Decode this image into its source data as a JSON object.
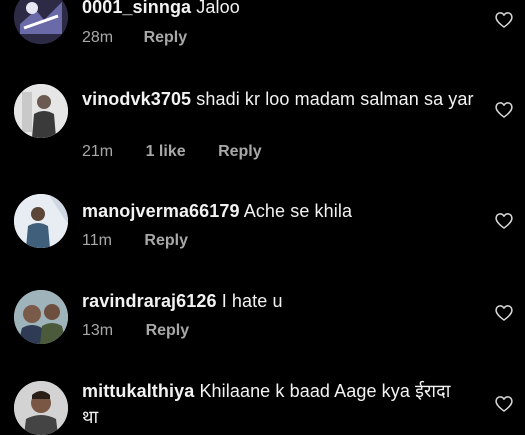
{
  "comments": [
    {
      "username": "0001_sinnga",
      "text": "Jaloo",
      "time": "28m",
      "likes": "",
      "reply_label": "Reply",
      "avatar_icon": "avatar-graphic-icon"
    },
    {
      "username": "vinodvk3705",
      "text": "shadi kr loo madam salman sa yar",
      "time": "21m",
      "likes": "1 like",
      "reply_label": "Reply",
      "avatar_icon": "avatar-person-icon"
    },
    {
      "username": "manojverma66179",
      "text": "Ache se khila",
      "time": "11m",
      "likes": "",
      "reply_label": "Reply",
      "avatar_icon": "avatar-person-icon"
    },
    {
      "username": "ravindraraj6126",
      "text": "I hate u",
      "time": "13m",
      "likes": "",
      "reply_label": "Reply",
      "avatar_icon": "avatar-person-icon"
    },
    {
      "username": "mittukalthiya",
      "text": "Khilaane  k baad  Aage  kya ईरादा था",
      "time": "",
      "likes": "",
      "reply_label": "",
      "avatar_icon": "avatar-person-icon"
    }
  ],
  "colors": {
    "background": "#000000",
    "primary_text": "#f2f2f2",
    "secondary_text": "#a8a8a8"
  },
  "icons": {
    "like": "heart-outline-icon"
  }
}
